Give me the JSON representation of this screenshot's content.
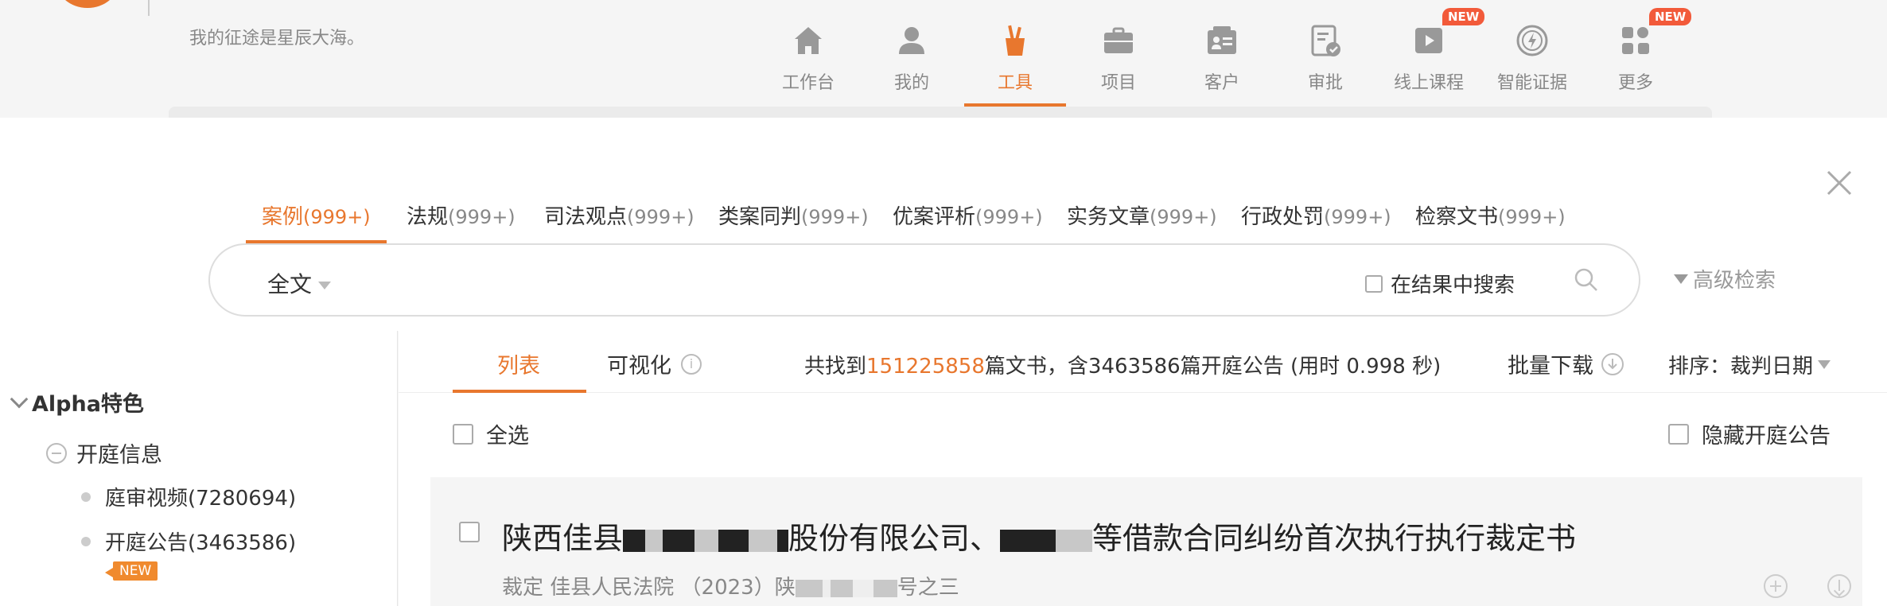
{
  "header": {
    "slogan": "我的征途是星辰大海。",
    "nav": [
      {
        "label": "工作台",
        "icon": "home-icon",
        "active": false
      },
      {
        "label": "我的",
        "icon": "user-icon",
        "active": false
      },
      {
        "label": "工具",
        "icon": "tools-icon",
        "active": true
      },
      {
        "label": "项目",
        "icon": "briefcase-icon",
        "active": false
      },
      {
        "label": "客户",
        "icon": "client-card-icon",
        "active": false
      },
      {
        "label": "审批",
        "icon": "approval-icon",
        "active": false
      },
      {
        "label": "线上课程",
        "icon": "video-course-icon",
        "active": false,
        "badge": "NEW"
      },
      {
        "label": "智能证据",
        "icon": "smart-evidence-icon",
        "active": false
      },
      {
        "label": "更多",
        "icon": "more-grid-icon",
        "active": false,
        "badge": "NEW"
      }
    ]
  },
  "search": {
    "tabs": [
      {
        "label": "案例",
        "count": "(999+)",
        "active": true
      },
      {
        "label": "法规",
        "count": "(999+)"
      },
      {
        "label": "司法观点",
        "count": "(999+)"
      },
      {
        "label": "类案同判",
        "count": "(999+)"
      },
      {
        "label": "优案评析",
        "count": "(999+)"
      },
      {
        "label": "实务文章",
        "count": "(999+)"
      },
      {
        "label": "行政处罚",
        "count": "(999+)"
      },
      {
        "label": "检察文书",
        "count": "(999+)"
      }
    ],
    "scope": "全文",
    "query": "",
    "in_result": "在结果中搜索",
    "advanced": "高级检索"
  },
  "sidebar": {
    "title": "Alpha特色",
    "group": "开庭信息",
    "items": [
      "庭审视频(7280694)",
      "开庭公告(3463586)"
    ],
    "new_badge": "NEW"
  },
  "results": {
    "view_tabs": [
      "列表",
      "可视化"
    ],
    "stats_prefix": "共找到",
    "stats_count": "151225858",
    "stats_suffix": "篇文书，含3463586篇开庭公告 (用时 0.998 秒)",
    "bulk_download": "批量下载",
    "sort": "排序：裁判日期",
    "select_all": "全选",
    "hide_open": "隐藏开庭公告",
    "item": {
      "title_a": "陕西佳县",
      "title_b": "股份有限公司、",
      "title_c": "等借款合同纠纷首次执行执行裁定书",
      "sub_a": "裁定 佳县人民法院 （2023）陕",
      "sub_b": "号之三"
    }
  },
  "colors": {
    "accent": "#e8772e",
    "badge": "#f25a3a"
  }
}
